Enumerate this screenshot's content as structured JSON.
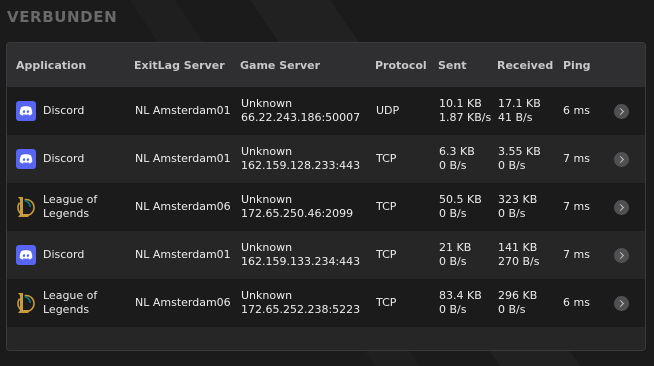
{
  "heading": "VERBUNDEN",
  "columns": {
    "application": "Application",
    "exitlag_server": "ExitLag Server",
    "game_server": "Game Server",
    "protocol": "Protocol",
    "sent": "Sent",
    "received": "Received",
    "ping": "Ping"
  },
  "rows": [
    {
      "icon": "discord-icon",
      "app_line1": "Discord",
      "app_line2": "",
      "exitlag_server": "NL Amsterdam01",
      "game_name": "Unknown",
      "game_addr": "66.22.243.186:50007",
      "protocol": "UDP",
      "sent_total": "10.1 KB",
      "sent_rate": "1.87 KB/s",
      "recv_total": "17.1 KB",
      "recv_rate": "41 B/s",
      "ping": "6 ms"
    },
    {
      "icon": "discord-icon",
      "app_line1": "Discord",
      "app_line2": "",
      "exitlag_server": "NL Amsterdam01",
      "game_name": "Unknown",
      "game_addr": "162.159.128.233:443",
      "protocol": "TCP",
      "sent_total": "6.3 KB",
      "sent_rate": "0 B/s",
      "recv_total": "3.55 KB",
      "recv_rate": "0 B/s",
      "ping": "7 ms"
    },
    {
      "icon": "league-of-legends-icon",
      "app_line1": "League of",
      "app_line2": "Legends",
      "exitlag_server": "NL Amsterdam06",
      "game_name": "Unknown",
      "game_addr": "172.65.250.46:2099",
      "protocol": "TCP",
      "sent_total": "50.5 KB",
      "sent_rate": "0 B/s",
      "recv_total": "323 KB",
      "recv_rate": "0 B/s",
      "ping": "7 ms"
    },
    {
      "icon": "discord-icon",
      "app_line1": "Discord",
      "app_line2": "",
      "exitlag_server": "NL Amsterdam01",
      "game_name": "Unknown",
      "game_addr": "162.159.133.234:443",
      "protocol": "TCP",
      "sent_total": "21 KB",
      "sent_rate": "0 B/s",
      "recv_total": "141 KB",
      "recv_rate": "270 B/s",
      "ping": "7 ms"
    },
    {
      "icon": "league-of-legends-icon",
      "app_line1": "League of",
      "app_line2": "Legends",
      "exitlag_server": "NL Amsterdam06",
      "game_name": "Unknown",
      "game_addr": "172.65.252.238:5223",
      "protocol": "TCP",
      "sent_total": "83.4 KB",
      "sent_rate": "0 B/s",
      "recv_total": "296 KB",
      "recv_rate": "0 B/s",
      "ping": "6 ms"
    }
  ],
  "colors": {
    "background": "#1b1b1c",
    "panel": "#262627",
    "header": "#2f2f31",
    "discord_brand": "#5865f2",
    "lol_gold": "#c89b3c"
  }
}
